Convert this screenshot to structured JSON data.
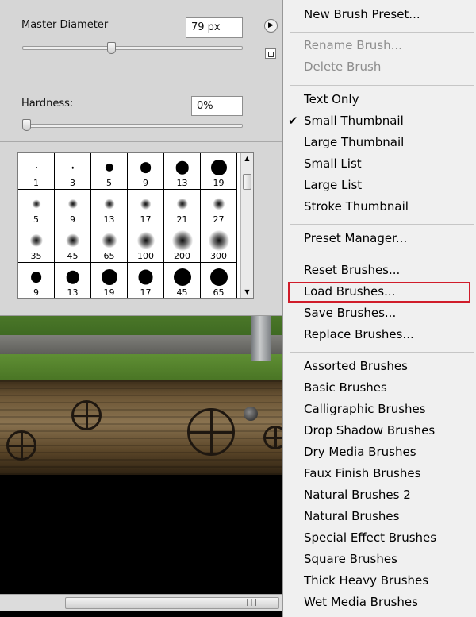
{
  "panel": {
    "master_diameter_label": "Master Diameter",
    "master_diameter_value": "79 px",
    "master_diameter_fraction": 0.4,
    "hardness_label": "Hardness:",
    "hardness_value": "0%",
    "hardness_fraction": 0.0
  },
  "brushes": [
    {
      "size": "1"
    },
    {
      "size": "3"
    },
    {
      "size": "5"
    },
    {
      "size": "9"
    },
    {
      "size": "13"
    },
    {
      "size": "19"
    },
    {
      "size": "5"
    },
    {
      "size": "9"
    },
    {
      "size": "13"
    },
    {
      "size": "17"
    },
    {
      "size": "21"
    },
    {
      "size": "27"
    },
    {
      "size": "35"
    },
    {
      "size": "45"
    },
    {
      "size": "65"
    },
    {
      "size": "100"
    },
    {
      "size": "200"
    },
    {
      "size": "300"
    },
    {
      "size": "9"
    },
    {
      "size": "13"
    },
    {
      "size": "19"
    },
    {
      "size": "17"
    },
    {
      "size": "45"
    },
    {
      "size": "65"
    }
  ],
  "menu": {
    "items": [
      {
        "label": "New Brush Preset...",
        "disabled": false
      },
      {
        "label": "Rename Brush...",
        "disabled": true
      },
      {
        "label": "Delete Brush",
        "disabled": true
      },
      {
        "label": "Text Only",
        "disabled": false
      },
      {
        "label": "Small Thumbnail",
        "disabled": false,
        "checked": true
      },
      {
        "label": "Large Thumbnail",
        "disabled": false
      },
      {
        "label": "Small List",
        "disabled": false
      },
      {
        "label": "Large List",
        "disabled": false
      },
      {
        "label": "Stroke Thumbnail",
        "disabled": false
      },
      {
        "label": "Preset Manager...",
        "disabled": false
      },
      {
        "label": "Reset Brushes...",
        "disabled": false
      },
      {
        "label": "Load Brushes...",
        "disabled": false,
        "highlighted": true
      },
      {
        "label": "Save Brushes...",
        "disabled": false
      },
      {
        "label": "Replace Brushes...",
        "disabled": false
      },
      {
        "label": "Assorted Brushes",
        "disabled": false
      },
      {
        "label": "Basic Brushes",
        "disabled": false
      },
      {
        "label": "Calligraphic Brushes",
        "disabled": false
      },
      {
        "label": "Drop Shadow Brushes",
        "disabled": false
      },
      {
        "label": "Dry Media Brushes",
        "disabled": false
      },
      {
        "label": "Faux Finish Brushes",
        "disabled": false
      },
      {
        "label": "Natural Brushes 2",
        "disabled": false
      },
      {
        "label": "Natural Brushes",
        "disabled": false
      },
      {
        "label": "Special Effect Brushes",
        "disabled": false
      },
      {
        "label": "Square Brushes",
        "disabled": false
      },
      {
        "label": "Thick Heavy Brushes",
        "disabled": false
      },
      {
        "label": "Wet Media Brushes",
        "disabled": false
      }
    ],
    "check_glyph": "✔"
  },
  "colors": {
    "highlight": "#d01c2a",
    "disabled_text": "#8d8d8d"
  },
  "icons": {
    "panel_menu": "play-arrow-icon",
    "new_preset": "new-preset-icon"
  },
  "scrollbar_grip": "|||"
}
